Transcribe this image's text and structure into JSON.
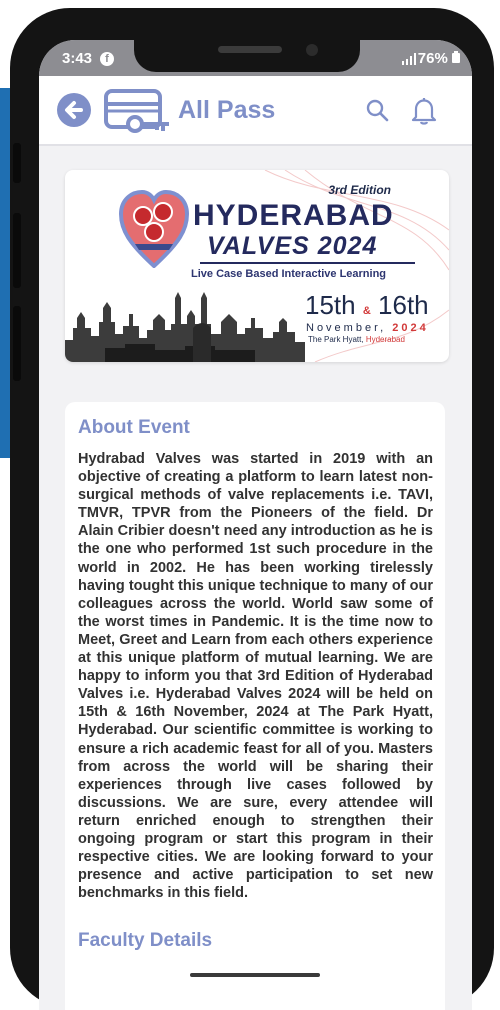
{
  "status_bar": {
    "time": "3:43",
    "battery": "76%"
  },
  "app_bar": {
    "back_icon": "arrow-left-icon",
    "title": "All Pass",
    "search_icon": "search-icon",
    "bell_icon": "bell-icon"
  },
  "banner": {
    "edition": "3rd Edition",
    "title": "HYDERABAD",
    "subtitle": "VALVES 2024",
    "tagline": "Live Case Based Interactive Learning",
    "date_start": "15th",
    "amp": "&",
    "date_end": "16th",
    "month": "November,",
    "year": "2024",
    "venue": "The Park Hyatt,",
    "city": "Hyderabad",
    "logo_text": "HYDERABAD VALVES"
  },
  "about": {
    "heading": "About Event",
    "body": "Hydrabad Valves was started in 2019 with an objective of creating a platform to learn latest non-surgical methods of valve replacements i.e. TAVI, TMVR, TPVR from the Pioneers of the field. Dr Alain Cribier doesn't need any introduction as he is the one who performed 1st such procedure in the world in 2002. He has been working tirelessly having tought this unique technique to many of our colleagues across the world. World saw some of the worst times in Pandemic. It is the time now to Meet, Greet and Learn from each others experience at this unique platform of mutual learning. We are happy to inform you that 3rd Edition of Hyderabad Valves i.e. Hyderabad Valves 2024 will be held on 15th & 16th November, 2024 at The Park Hyatt, Hyderabad. Our scientific committee is working to ensure a rich academic feast for all of you. Masters from across the world will be sharing their experiences through live cases followed by discussions. We are sure, every attendee will return enriched enough to strengthen their ongoing program or start this program in their respective cities. We are looking forward to your presence and active participation to set new benchmarks in this field."
  },
  "faculty": {
    "heading": "Faculty Details"
  },
  "colors": {
    "accent": "#7f8fc8",
    "status_bar": "#8d8d92",
    "banner_navy": "#242a5e",
    "banner_red": "#d23a3a"
  }
}
